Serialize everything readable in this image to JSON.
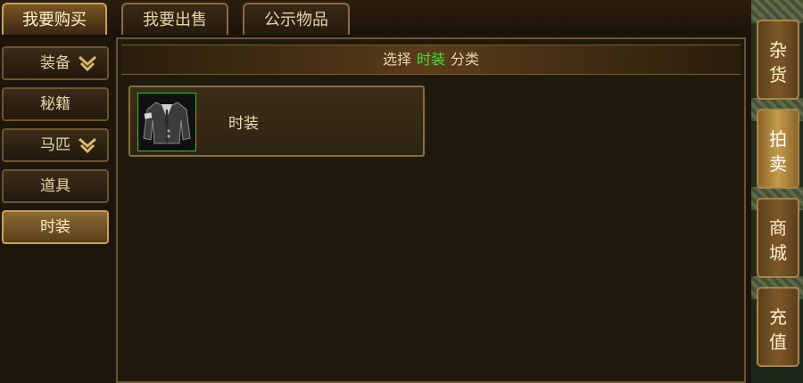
{
  "tabs": [
    "我要购买",
    "我要出售",
    "公示物品"
  ],
  "categories": [
    "装备",
    "秘籍",
    "马匹",
    "道具",
    "时装"
  ],
  "header": {
    "prefix": "选择",
    "highlight": "时装",
    "suffix": "分类"
  },
  "item": {
    "name": "时装",
    "icon": "suit-jacket-icon"
  },
  "side_menu": [
    {
      "line1": "杂",
      "line2": "货"
    },
    {
      "line1": "拍",
      "line2": "卖"
    },
    {
      "line1": "商",
      "line2": "城"
    },
    {
      "line1": "充",
      "line2": "值"
    }
  ],
  "colors": {
    "highlight": "#3ee03e",
    "accent": "#c9a05a"
  }
}
